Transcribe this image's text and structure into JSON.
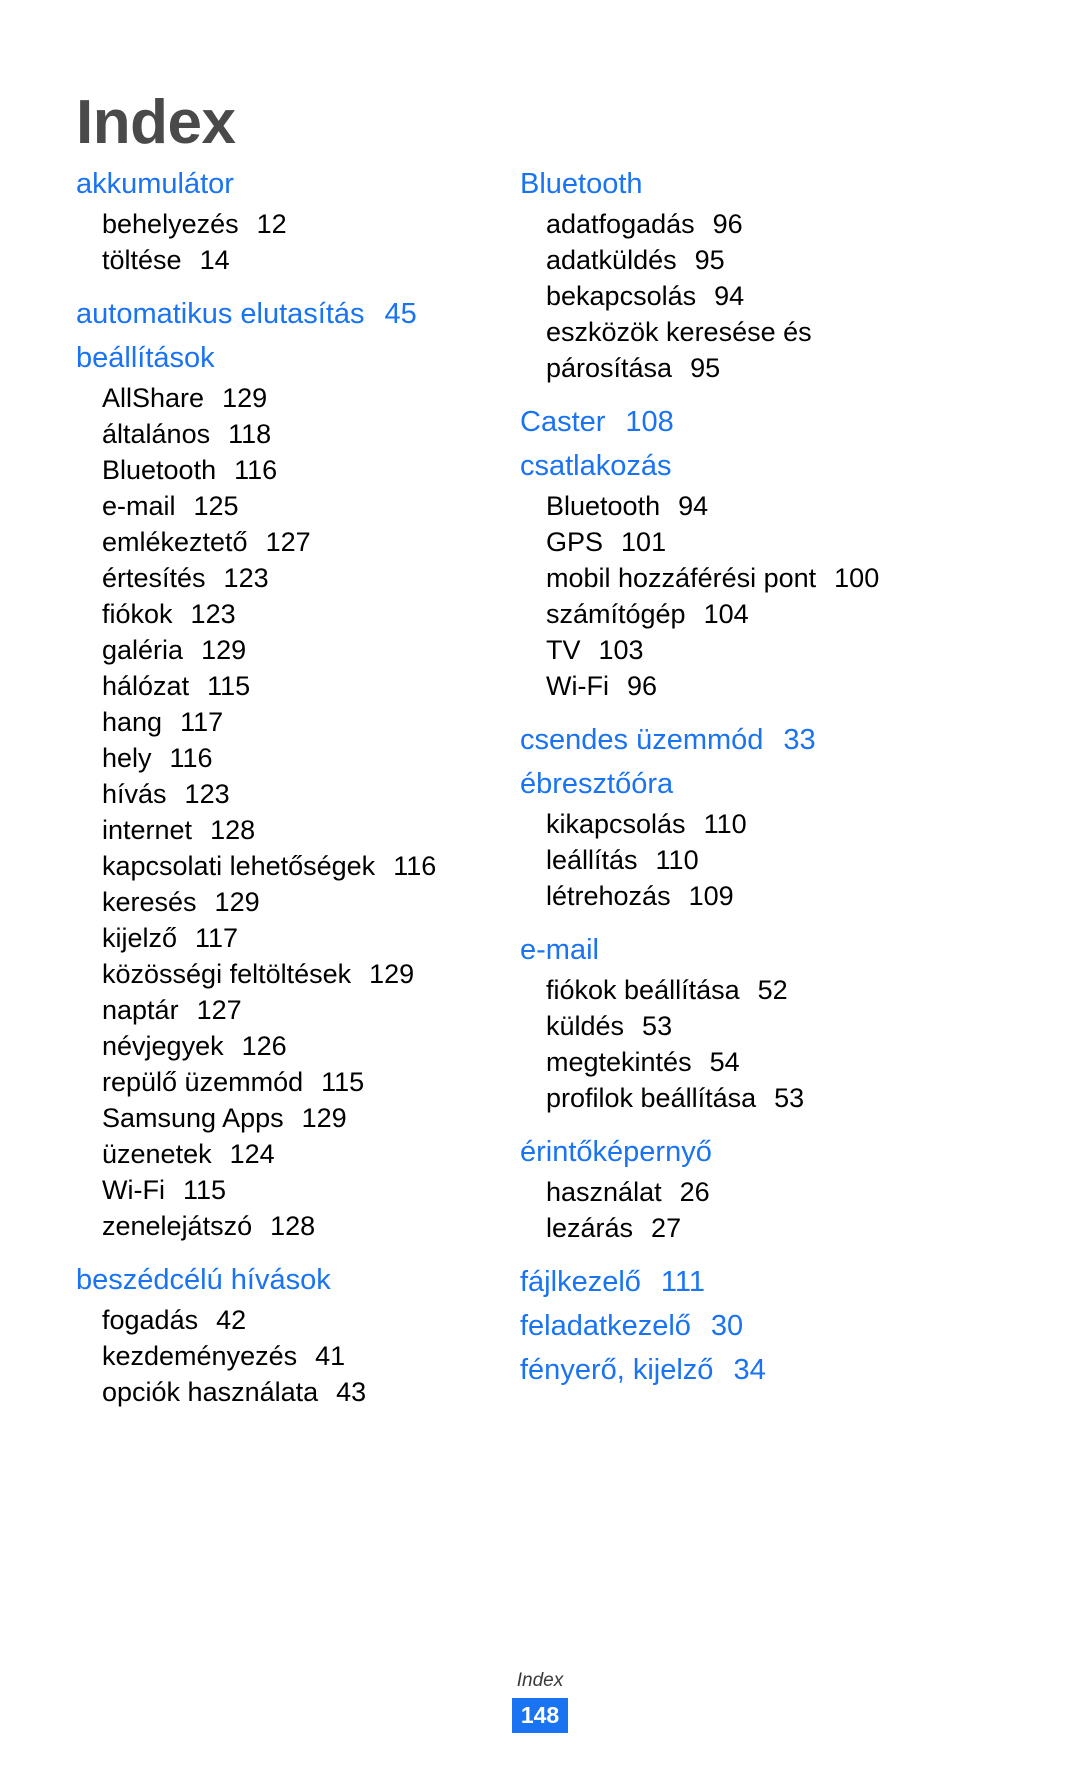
{
  "document": {
    "title": "Index",
    "heading_color": "#1a73f0",
    "title_color": "#4a4a4a",
    "body_color": "#000000"
  },
  "columns": [
    {
      "id": "column-left",
      "groups": [
        {
          "heading": "akkumulátor",
          "heading_page": "",
          "entries": [
            {
              "label": "behelyezés",
              "page": "12"
            },
            {
              "label": "töltése",
              "page": "14"
            }
          ]
        },
        {
          "heading": "automatikus elutasítás",
          "heading_page": "45",
          "entries": []
        },
        {
          "heading": "beállítások",
          "heading_page": "",
          "entries": [
            {
              "label": "AllShare",
              "page": "129"
            },
            {
              "label": "általános",
              "page": "118"
            },
            {
              "label": "Bluetooth",
              "page": "116"
            },
            {
              "label": "e-mail",
              "page": "125"
            },
            {
              "label": "emlékeztető",
              "page": "127"
            },
            {
              "label": "értesítés",
              "page": "123"
            },
            {
              "label": "fiókok",
              "page": "123"
            },
            {
              "label": "galéria",
              "page": "129"
            },
            {
              "label": "hálózat",
              "page": "115"
            },
            {
              "label": "hang",
              "page": "117"
            },
            {
              "label": "hely",
              "page": "116"
            },
            {
              "label": "hívás",
              "page": "123"
            },
            {
              "label": "internet",
              "page": "128"
            },
            {
              "label": "kapcsolati lehetőségek",
              "page": "116"
            },
            {
              "label": "keresés",
              "page": "129"
            },
            {
              "label": "kijelző",
              "page": "117"
            },
            {
              "label": "közösségi feltöltések",
              "page": "129"
            },
            {
              "label": "naptár",
              "page": "127"
            },
            {
              "label": "névjegyek",
              "page": "126"
            },
            {
              "label": "repülő üzemmód",
              "page": "115"
            },
            {
              "label": "Samsung Apps",
              "page": "129"
            },
            {
              "label": "üzenetek",
              "page": "124"
            },
            {
              "label": "Wi-Fi",
              "page": "115"
            },
            {
              "label": "zenelejátszó",
              "page": "128"
            }
          ]
        },
        {
          "heading": "beszédcélú hívások",
          "heading_page": "",
          "entries": [
            {
              "label": "fogadás",
              "page": "42"
            },
            {
              "label": "kezdeményezés",
              "page": "41"
            },
            {
              "label": "opciók használata",
              "page": "43"
            }
          ]
        }
      ]
    },
    {
      "id": "column-right",
      "groups": [
        {
          "heading": "Bluetooth",
          "heading_page": "",
          "entries": [
            {
              "label": "adatfogadás",
              "page": "96"
            },
            {
              "label": "adatküldés",
              "page": "95"
            },
            {
              "label": "bekapcsolás",
              "page": "94"
            },
            {
              "label": "eszközök keresése és párosítása",
              "page": "95"
            }
          ]
        },
        {
          "heading": "Caster",
          "heading_page": "108",
          "entries": []
        },
        {
          "heading": "csatlakozás",
          "heading_page": "",
          "entries": [
            {
              "label": "Bluetooth",
              "page": "94"
            },
            {
              "label": "GPS",
              "page": "101"
            },
            {
              "label": "mobil hozzáférési pont",
              "page": "100"
            },
            {
              "label": "számítógép",
              "page": "104"
            },
            {
              "label": "TV",
              "page": "103"
            },
            {
              "label": "Wi-Fi",
              "page": "96"
            }
          ]
        },
        {
          "heading": "csendes üzemmód",
          "heading_page": "33",
          "entries": []
        },
        {
          "heading": "ébresztőóra",
          "heading_page": "",
          "entries": [
            {
              "label": "kikapcsolás",
              "page": "110"
            },
            {
              "label": "leállítás",
              "page": "110"
            },
            {
              "label": "létrehozás",
              "page": "109"
            }
          ]
        },
        {
          "heading": "e-mail",
          "heading_page": "",
          "entries": [
            {
              "label": "fiókok beállítása",
              "page": "52"
            },
            {
              "label": "küldés",
              "page": "53"
            },
            {
              "label": "megtekintés",
              "page": "54"
            },
            {
              "label": "profilok beállítása",
              "page": "53"
            }
          ]
        },
        {
          "heading": "érintőképernyő",
          "heading_page": "",
          "entries": [
            {
              "label": "használat",
              "page": "26"
            },
            {
              "label": "lezárás",
              "page": "27"
            }
          ]
        },
        {
          "heading": "fájlkezelő",
          "heading_page": "111",
          "entries": []
        },
        {
          "heading": "feladatkezelő",
          "heading_page": "30",
          "entries": []
        },
        {
          "heading": "fényerő, kijelző",
          "heading_page": "34",
          "entries": []
        }
      ]
    }
  ],
  "footer": {
    "label": "Index",
    "page_number": "148"
  }
}
